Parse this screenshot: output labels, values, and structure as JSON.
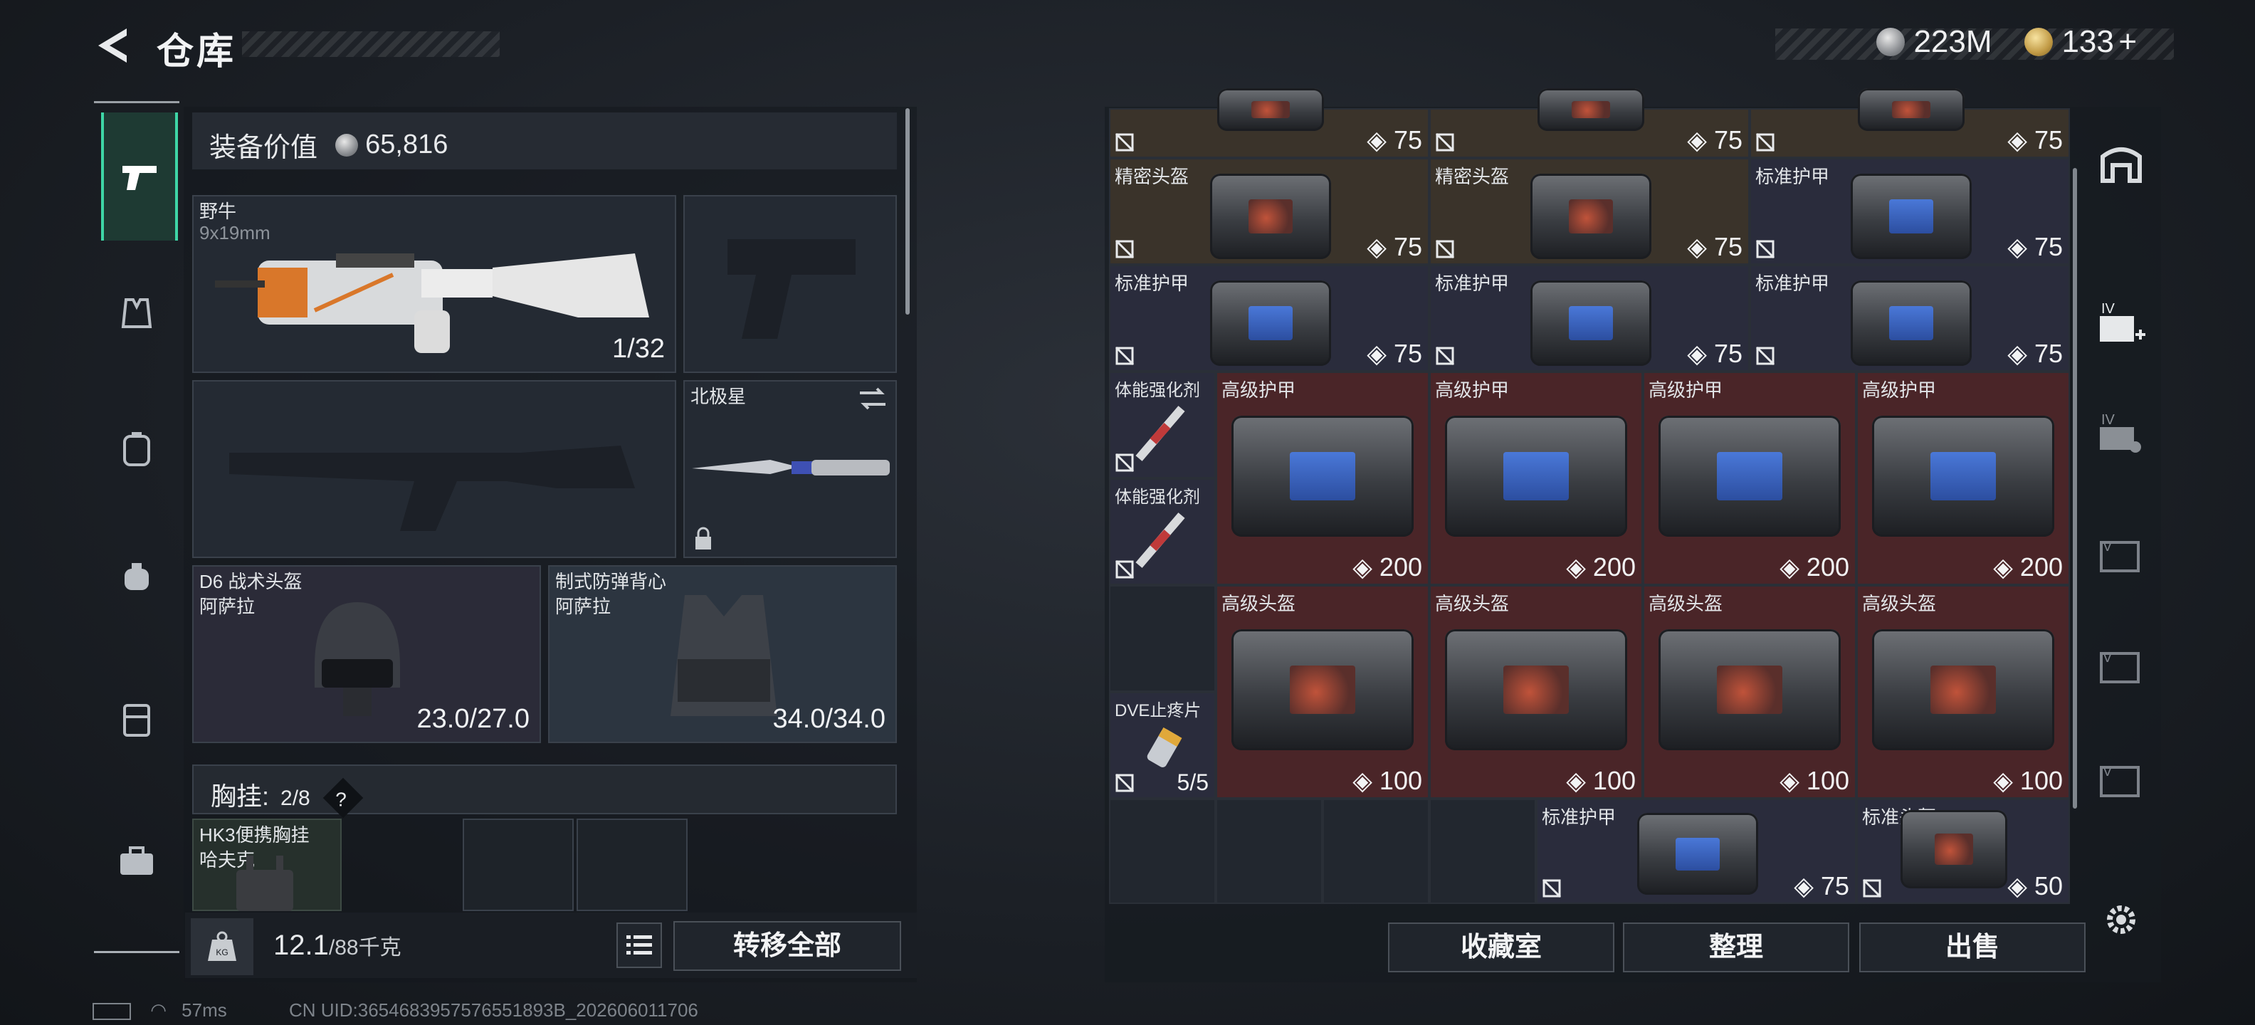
{
  "header": {
    "title": "仓库",
    "silver_amount": "223M",
    "gold_amount": "133",
    "gold_plus": "+"
  },
  "left": {
    "equip_value_label": "装备价值",
    "equip_value": "65,816",
    "primary_name": "野牛",
    "primary_caliber": "9x19mm",
    "primary_ammo": "1/32",
    "melee_name": "北极星",
    "helmet_name": "D6 战术头盔",
    "helmet_sub": "阿萨拉",
    "helmet_durability": "23.0/27.0",
    "armor_name": "制式防弹背心",
    "armor_sub": "阿萨拉",
    "armor_durability": "34.0/34.0",
    "rig_label": "胸挂:",
    "rig_count": "2/8",
    "rig_help": "?",
    "rig_item_name": "HK3便携胸挂",
    "rig_item_sub": "哈夫克",
    "weight": "12.1",
    "weight_max": "/88千克",
    "kg_icon": "KG",
    "transfer_all": "转移全部"
  },
  "grid": {
    "row0": [
      "75",
      "75",
      "75"
    ],
    "row1": [
      {
        "name": "精密头盔",
        "dur": "75"
      },
      {
        "name": "精密头盔",
        "dur": "75"
      },
      {
        "name": "标准护甲",
        "dur": "75"
      }
    ],
    "row2": [
      {
        "name": "标准护甲",
        "dur": "75"
      },
      {
        "name": "标准护甲",
        "dur": "75"
      },
      {
        "name": "标准护甲",
        "dur": "75"
      }
    ],
    "stim1": "体能强化剂",
    "stim2": "体能强化剂",
    "adv_armor": [
      {
        "name": "高级护甲",
        "dur": "200"
      },
      {
        "name": "高级护甲",
        "dur": "200"
      },
      {
        "name": "高级护甲",
        "dur": "200"
      },
      {
        "name": "高级护甲",
        "dur": "200"
      }
    ],
    "adv_helmet": [
      {
        "name": "高级头盔",
        "dur": "100"
      },
      {
        "name": "高级头盔",
        "dur": "100"
      },
      {
        "name": "高级头盔",
        "dur": "100"
      },
      {
        "name": "高级头盔",
        "dur": "100"
      }
    ],
    "painkiller_name": "DVE止疼片",
    "painkiller_count": "5/5",
    "last_row": [
      {
        "name": "标准护甲",
        "dur": "75"
      },
      {
        "name": "标准头盔",
        "dur": "50"
      }
    ]
  },
  "buttons": {
    "collection": "收藏室",
    "sort": "整理",
    "sell": "出售"
  },
  "side": {
    "iv1": "IV",
    "iv2": "IV",
    "v1": "V",
    "v2": "V",
    "v3": "V"
  },
  "footer": {
    "ping": "57ms",
    "uid": "CN UID:3654683957576551893B_202606011706"
  }
}
